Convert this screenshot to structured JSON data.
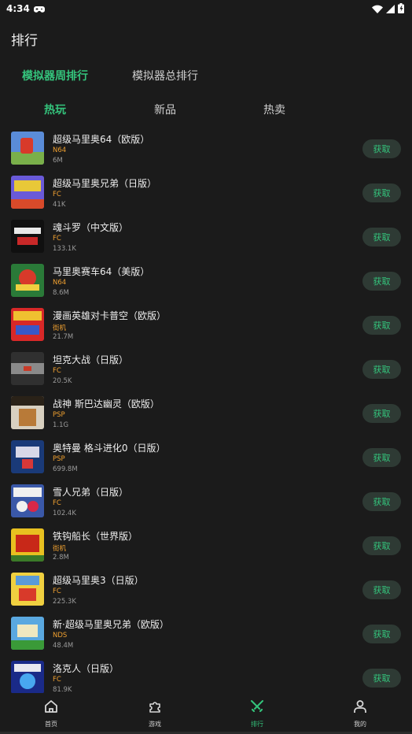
{
  "status_bar": {
    "time": "4:34"
  },
  "page_title": "排行",
  "top_tabs": [
    {
      "label": "模拟器周排行",
      "active": true
    },
    {
      "label": "模拟器总排行",
      "active": false
    }
  ],
  "sub_tabs": [
    {
      "label": "热玩",
      "active": true
    },
    {
      "label": "新品",
      "active": false
    },
    {
      "label": "热卖",
      "active": false
    }
  ],
  "action_label": "获取",
  "games": [
    {
      "name": "超级马里奥64（欧版）",
      "platform": "N64",
      "size": "6M",
      "colors": [
        "#5a8cd8",
        "#d83a2a",
        "#7ab04a"
      ]
    },
    {
      "name": "超级马里奥兄弟（日版）",
      "platform": "FC",
      "size": "41K",
      "colors": [
        "#6a5ad8",
        "#e8c838",
        "#d84a2a"
      ]
    },
    {
      "name": "魂斗罗（中文版）",
      "platform": "FC",
      "size": "133.1K",
      "colors": [
        "#101010",
        "#e8e8e8",
        "#c82828"
      ]
    },
    {
      "name": "马里奥赛车64（美版）",
      "platform": "N64",
      "size": "8.6M",
      "colors": [
        "#2a7a38",
        "#d83a2a",
        "#f0d040"
      ]
    },
    {
      "name": "漫画英雄对卡普空（欧版）",
      "platform": "街机",
      "size": "21.7M",
      "colors": [
        "#d82828",
        "#f0c030",
        "#3a58c8"
      ]
    },
    {
      "name": "坦克大战（日版）",
      "platform": "FC",
      "size": "20.5K",
      "colors": [
        "#303030",
        "#8a8a8a",
        "#c83a28"
      ]
    },
    {
      "name": "战神 斯巴达幽灵（欧版）",
      "platform": "PSP",
      "size": "1.1G",
      "colors": [
        "#d8d0c0",
        "#2a2218",
        "#b87a38"
      ]
    },
    {
      "name": "奥特曼 格斗进化0（日版）",
      "platform": "PSP",
      "size": "699.8M",
      "colors": [
        "#1a3a78",
        "#d8d8e8",
        "#d83838"
      ]
    },
    {
      "name": "雪人兄弟（日版）",
      "platform": "FC",
      "size": "102.4K",
      "colors": [
        "#3a58a8",
        "#f0f0f0",
        "#d82848"
      ]
    },
    {
      "name": "铁钩船长（世界版）",
      "platform": "街机",
      "size": "2.8M",
      "colors": [
        "#e8c020",
        "#c82818",
        "#3a7a28"
      ]
    },
    {
      "name": "超级马里奥3（日版）",
      "platform": "FC",
      "size": "225.3K",
      "colors": [
        "#f0d040",
        "#5a9ad8",
        "#d83a2a"
      ]
    },
    {
      "name": "新·超级马里奥兄弟（欧版）",
      "platform": "NDS",
      "size": "48.4M",
      "colors": [
        "#5aa8e0",
        "#f0e8c0",
        "#3a9a38"
      ]
    },
    {
      "name": "洛克人（日版）",
      "platform": "FC",
      "size": "81.9K",
      "colors": [
        "#1a2a88",
        "#48a8f0",
        "#e8e8f0"
      ]
    }
  ],
  "bottom_nav": [
    {
      "label": "首页",
      "icon": "home-icon",
      "active": false
    },
    {
      "label": "游戏",
      "icon": "puzzle-icon",
      "active": false
    },
    {
      "label": "排行",
      "icon": "crossed-swords-icon",
      "active": true
    },
    {
      "label": "我的",
      "icon": "person-icon",
      "active": false
    }
  ],
  "accent_color": "#34c47c",
  "platform_color": "#f0a030"
}
